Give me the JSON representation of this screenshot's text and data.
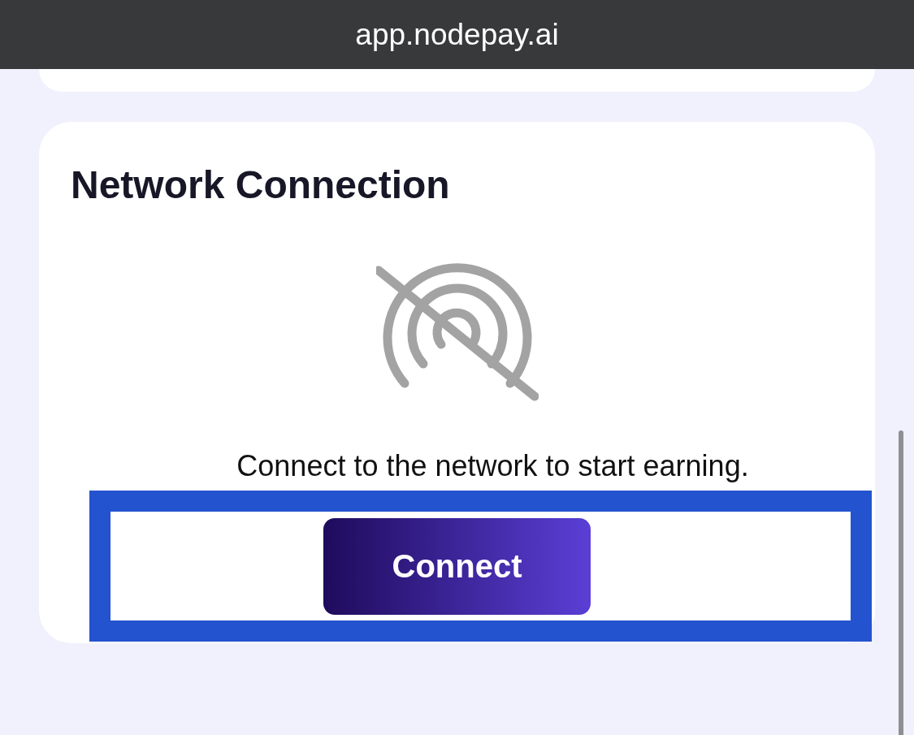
{
  "browser": {
    "address": "app.nodepay.ai"
  },
  "card": {
    "title": "Network Connection",
    "message": "Connect to the network to start earning."
  },
  "connect_button": {
    "label": "Connect",
    "highlighted": true
  }
}
